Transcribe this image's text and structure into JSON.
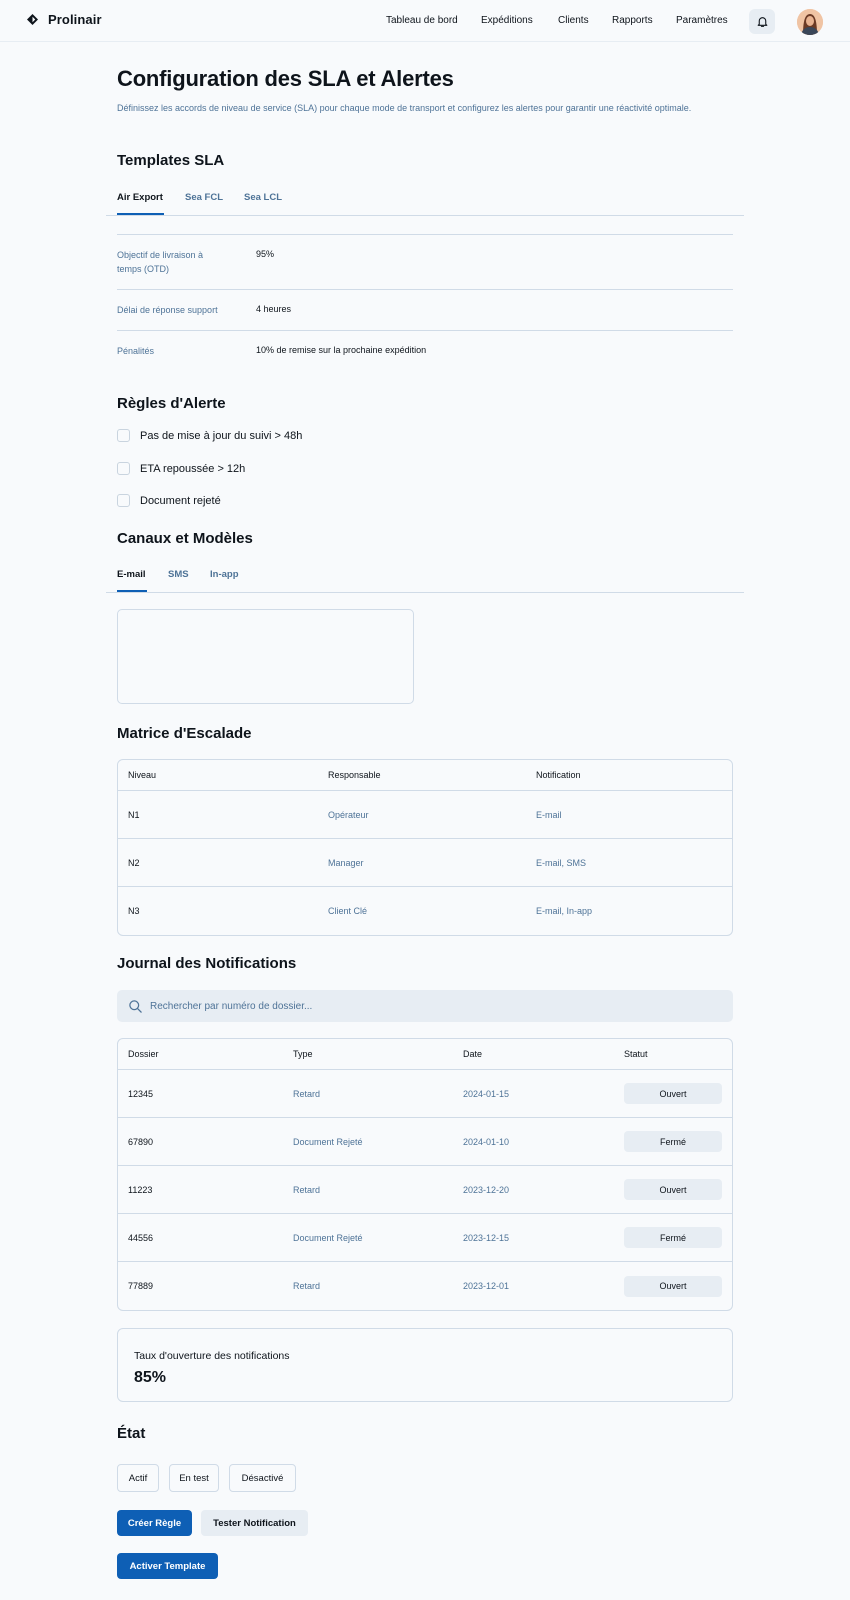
{
  "app": {
    "name": "Prolinair"
  },
  "nav": {
    "items": [
      {
        "label": "Tableau de bord"
      },
      {
        "label": "Expéditions"
      },
      {
        "label": "Clients"
      },
      {
        "label": "Rapports"
      },
      {
        "label": "Paramètres"
      }
    ],
    "icons": {
      "notifications": "bell-icon",
      "profile": "avatar"
    }
  },
  "page": {
    "title": "Configuration des SLA et Alertes",
    "description": "Définissez les accords de niveau de service (SLA) pour chaque mode de transport et configurez les alertes pour garantir une réactivité optimale."
  },
  "sla": {
    "heading": "Templates SLA",
    "tabs": [
      {
        "label": "Air Export",
        "active": true
      },
      {
        "label": "Sea FCL",
        "active": false
      },
      {
        "label": "Sea LCL",
        "active": false
      }
    ],
    "rows": [
      {
        "label": "Objectif de livraison à temps (OTD)",
        "value": "95%"
      },
      {
        "label": "Délai de réponse support",
        "value": "4 heures"
      },
      {
        "label": "Pénalités",
        "value": "10% de remise sur la prochaine expédition"
      }
    ]
  },
  "alerts": {
    "heading": "Règles d'Alerte",
    "rules": [
      {
        "label": "Pas de mise à jour du suivi > 48h",
        "checked": false
      },
      {
        "label": "ETA repoussée > 12h",
        "checked": false
      },
      {
        "label": "Document rejeté",
        "checked": false
      }
    ]
  },
  "channels": {
    "heading": "Canaux et Modèles",
    "tabs": [
      {
        "label": "E-mail",
        "active": true
      },
      {
        "label": "SMS",
        "active": false
      },
      {
        "label": "In-app",
        "active": false
      }
    ],
    "template_value": ""
  },
  "escalation": {
    "heading": "Matrice d'Escalade",
    "columns": [
      "Niveau",
      "Responsable",
      "Notification"
    ],
    "rows": [
      [
        "N1",
        "Opérateur",
        "E-mail"
      ],
      [
        "N2",
        "Manager",
        "E-mail, SMS"
      ],
      [
        "N3",
        "Client Clé",
        "E-mail, In-app"
      ]
    ]
  },
  "journal": {
    "heading": "Journal des Notifications",
    "search_placeholder": "Rechercher par numéro de dossier...",
    "columns": [
      "Dossier",
      "Type",
      "Date",
      "Statut"
    ],
    "rows": [
      [
        "12345",
        "Retard",
        "2024-01-15",
        "Ouvert"
      ],
      [
        "67890",
        "Document Rejeté",
        "2024-01-10",
        "Fermé"
      ],
      [
        "11223",
        "Retard",
        "2023-12-20",
        "Ouvert"
      ],
      [
        "44556",
        "Document Rejeté",
        "2023-12-15",
        "Fermé"
      ],
      [
        "77889",
        "Retard",
        "2023-12-01",
        "Ouvert"
      ]
    ]
  },
  "stats": {
    "open_rate_label": "Taux d'ouverture des notifications",
    "open_rate_value": "85%"
  },
  "state": {
    "heading": "État",
    "options": [
      "Actif",
      "En test",
      "Désactivé"
    ]
  },
  "actions": {
    "create_rule": "Créer Règle",
    "test_notification": "Tester Notification",
    "activate_template": "Activer Template"
  },
  "colors": {
    "primary": "#0e5fb5",
    "text": "#0e141b",
    "muted": "#4e7397",
    "border": "#d0dbe7",
    "surface": "#e7edf3",
    "background": "#f8fafc"
  }
}
